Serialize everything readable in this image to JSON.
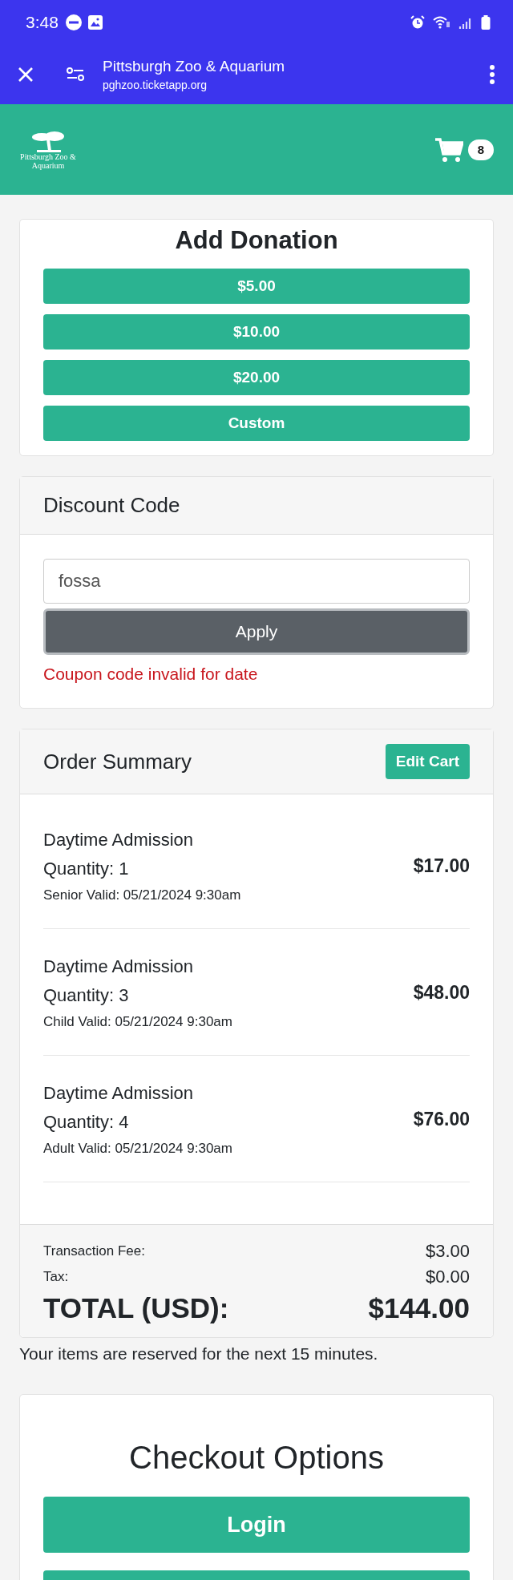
{
  "status_bar": {
    "time": "3:48"
  },
  "browser_bar": {
    "title": "Pittsburgh Zoo & Aquarium",
    "url": "pghzoo.ticketapp.org"
  },
  "site_header": {
    "logo_text": "Pittsburgh Zoo & Aquarium",
    "cart_count": "8"
  },
  "donation": {
    "title": "Add Donation",
    "options": [
      "$5.00",
      "$10.00",
      "$20.00",
      "Custom"
    ]
  },
  "discount": {
    "title": "Discount Code",
    "code": "fossa",
    "apply": "Apply",
    "error": "Coupon code invalid for date"
  },
  "order_summary": {
    "title": "Order Summary",
    "edit_button": "Edit Cart",
    "items": [
      {
        "name": "Daytime Admission",
        "quantity": "Quantity: 1",
        "detail": "Senior Valid: 05/21/2024 9:30am",
        "price": "$17.00"
      },
      {
        "name": "Daytime Admission",
        "quantity": "Quantity: 3",
        "detail": "Child Valid: 05/21/2024 9:30am",
        "price": "$48.00"
      },
      {
        "name": "Daytime Admission",
        "quantity": "Quantity: 4",
        "detail": "Adult Valid: 05/21/2024 9:30am",
        "price": "$76.00"
      }
    ],
    "fees": [
      {
        "label": "Transaction Fee:",
        "value": "$3.00"
      },
      {
        "label": "Tax:",
        "value": "$0.00"
      }
    ],
    "total_label": "TOTAL (USD):",
    "total_value": "$144.00"
  },
  "reservation_note": "Your items are reserved for the next 15 minutes.",
  "checkout": {
    "title": "Checkout Options",
    "buttons": [
      "Login"
    ]
  }
}
